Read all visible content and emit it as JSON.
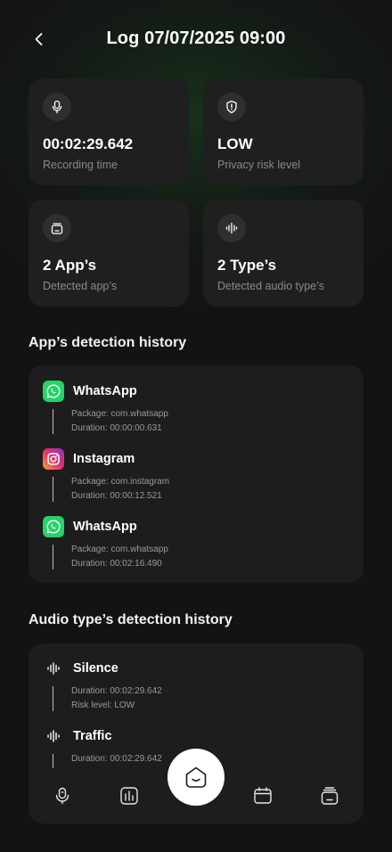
{
  "header": {
    "title": "Log 07/07/2025 09:00"
  },
  "stats": [
    {
      "value": "00:02:29.642",
      "label": "Recording time",
      "icon": "microphone-icon"
    },
    {
      "value": "LOW",
      "label": "Privacy risk level",
      "icon": "shield-alert-icon"
    },
    {
      "value": "2 App’s",
      "label": "Detected app’s",
      "icon": "app-stack-icon"
    },
    {
      "value": "2 Type’s",
      "label": "Detected audio type’s",
      "icon": "audio-wave-icon"
    }
  ],
  "app_history": {
    "title": "App’s detection history",
    "items": [
      {
        "name": "WhatsApp",
        "package": "Package: com.whatsapp",
        "duration": "Duration: 00:00:00.631",
        "icon": "whatsapp-icon"
      },
      {
        "name": "Instagram",
        "package": "Package: com.instagram",
        "duration": "Duration: 00:00:12.521",
        "icon": "instagram-icon"
      },
      {
        "name": "WhatsApp",
        "package": "Package: com.whatsapp",
        "duration": "Duration: 00:02:16.490",
        "icon": "whatsapp-icon"
      }
    ]
  },
  "audio_history": {
    "title": "Audio type’s detection history",
    "items": [
      {
        "name": "Silence",
        "duration": "Duration: 00:02:29.642",
        "risk": "Risk level: LOW",
        "icon": "audio-wave-icon"
      },
      {
        "name": "Traffic",
        "duration": "Duration: 00:02:29.642",
        "icon": "audio-wave-icon"
      }
    ]
  },
  "nav": {
    "items": [
      "voice-recorder-icon",
      "equalizer-icon",
      "home-icon",
      "calendar-icon",
      "app-stack-icon"
    ],
    "active": "home-icon"
  },
  "colors": {
    "whatsapp": "#25d366",
    "instagram_start": "#f9a23b",
    "instagram_end": "#8a34c4"
  }
}
